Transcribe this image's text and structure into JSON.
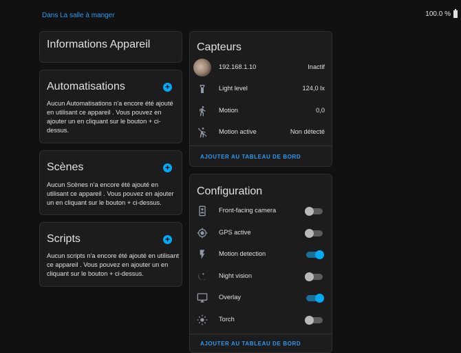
{
  "header": {
    "area_link": "Dans La salle à manger",
    "battery": "100.0 %"
  },
  "device_info": {
    "title": "Informations Appareil"
  },
  "automations": {
    "title": "Automatisations",
    "text": "Aucun Automatisations n'a encore été ajouté en utilisant ce appareil . Vous pouvez en ajouter un en cliquant sur le bouton + ci-dessus."
  },
  "scenes": {
    "title": "Scènes",
    "text": "Aucun Scènes n'a encore été ajouté en utilisant ce appareil . Vous pouvez en ajouter un en cliquant sur le bouton + ci-dessus."
  },
  "scripts": {
    "title": "Scripts",
    "text": "Aucun scripts n'a encore été ajouté en utilisant ce appareil . Vous pouvez en ajouter un en cliquant sur le bouton + ci-dessus."
  },
  "sensors": {
    "title": "Capteurs",
    "items": [
      {
        "label": "192.168.1.10",
        "value": "Inactif",
        "icon": "camera-thumbnail"
      },
      {
        "label": "Light level",
        "value": "124,0 lx",
        "icon": "flashlight-icon"
      },
      {
        "label": "Motion",
        "value": "0,0",
        "icon": "walk-icon"
      },
      {
        "label": "Motion active",
        "value": "Non détecté",
        "icon": "motion-off-icon"
      }
    ],
    "action": "AJOUTER AU TABLEAU DE BORD"
  },
  "configuration": {
    "title": "Configuration",
    "items": [
      {
        "label": "Front-facing camera",
        "on": false,
        "icon": "phone-camera-icon"
      },
      {
        "label": "GPS active",
        "on": false,
        "icon": "crosshairs-gps-icon"
      },
      {
        "label": "Motion detection",
        "on": true,
        "icon": "flash-icon"
      },
      {
        "label": "Night vision",
        "on": false,
        "icon": "weather-night-icon"
      },
      {
        "label": "Overlay",
        "on": true,
        "icon": "monitor-icon"
      },
      {
        "label": "Torch",
        "on": false,
        "icon": "brightness-icon"
      }
    ],
    "action": "AJOUTER AU TABLEAU DE BORD"
  },
  "colors": {
    "accent": "#03a9f4",
    "link": "#2b9af3",
    "background": "#111111",
    "card": "#1c1c1c"
  }
}
